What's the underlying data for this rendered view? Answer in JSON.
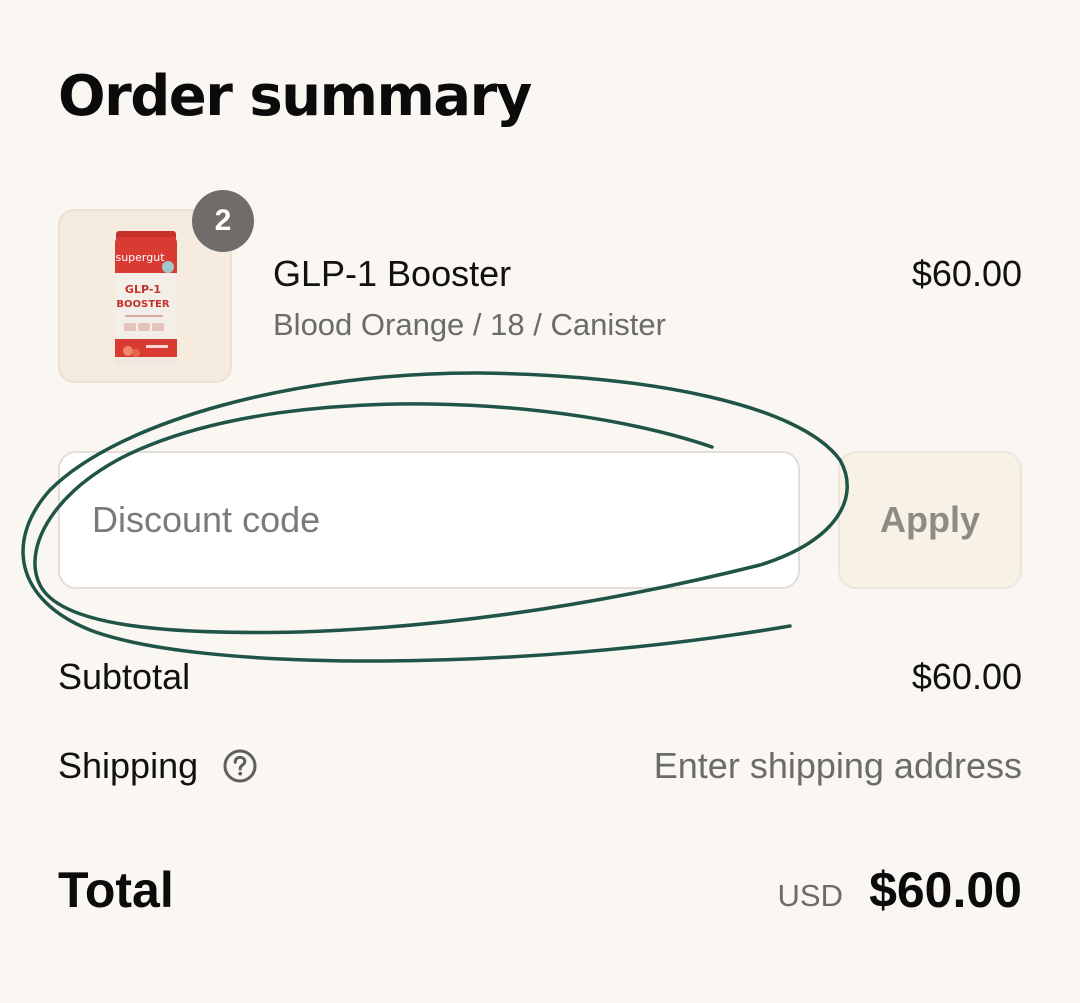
{
  "header": {
    "title": "Order summary"
  },
  "line_item": {
    "quantity": "2",
    "name": "GLP-1 Booster",
    "variant": "Blood Orange / 18 / Canister",
    "price": "$60.00",
    "image": {
      "brand": "supergut",
      "product_line1": "GLP-1",
      "product_line2": "BOOSTER"
    }
  },
  "discount": {
    "placeholder": "Discount code",
    "value": "",
    "apply_label": "Apply"
  },
  "summary": {
    "subtotal_label": "Subtotal",
    "subtotal_value": "$60.00",
    "shipping_label": "Shipping",
    "shipping_icon": "question-circle-icon",
    "shipping_value": "Enter shipping address",
    "total_label": "Total",
    "currency": "USD",
    "total_value": "$60.00"
  },
  "colors": {
    "background": "#faf7f3",
    "badge": "#6f6c69",
    "scribble": "#1f5447",
    "brand_red": "#d93a32",
    "muted_text": "#6b6b6b"
  }
}
